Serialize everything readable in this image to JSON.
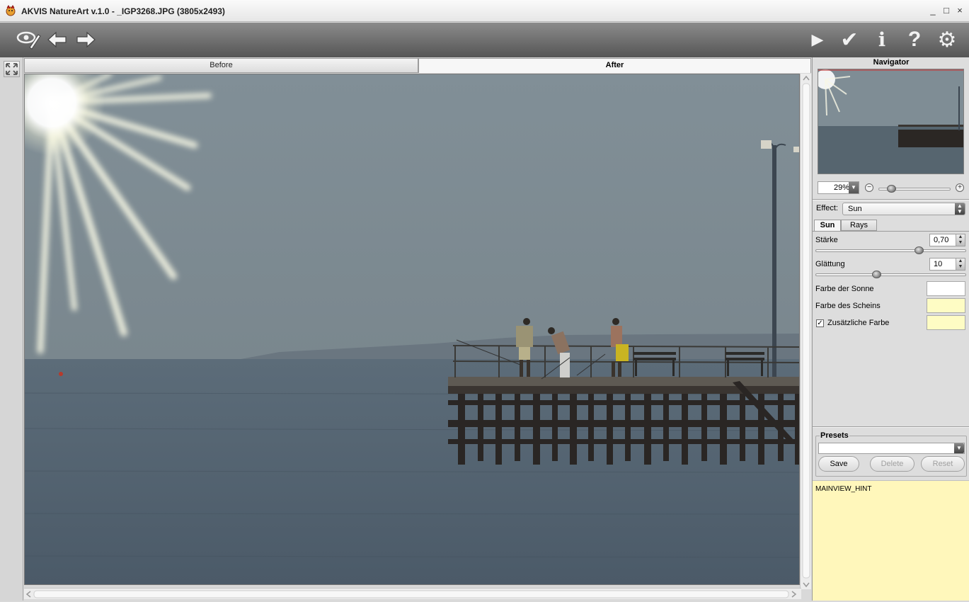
{
  "window": {
    "title": "AKVIS NatureArt v.1.0 - _IGP3268.JPG (3805x2493)",
    "controls": [
      "_",
      "□",
      "×"
    ]
  },
  "toolbar": {
    "left_icons": [
      "eye-brush-icon",
      "undo-arrow-icon",
      "redo-arrow-icon"
    ],
    "right_icons": [
      "play-icon",
      "checkmark-icon",
      "info-icon",
      "help-icon",
      "settings-gear-icon"
    ],
    "play_icon_glyph": "▶",
    "apply_icon_glyph": "✔",
    "info_icon_glyph": "i",
    "help_icon_glyph": "?",
    "settings_icon_glyph": "⚙"
  },
  "view_tabs": {
    "before": "Before",
    "after": "After",
    "active": "After"
  },
  "navigator": {
    "title": "Navigator",
    "zoom": "29%",
    "zoom_level_fraction": 0.14,
    "zoom_out": "−",
    "zoom_in": "+",
    "dropdown_arrow": "▼"
  },
  "effect": {
    "label": "Effect:",
    "value": "Sun"
  },
  "param_tabs": {
    "sun": "Sun",
    "rays": "Rays",
    "active": "Sun"
  },
  "params": {
    "staerke": {
      "label": "Stärke",
      "value": "0,70",
      "fraction": 0.7
    },
    "glaettung": {
      "label": "Glättung",
      "value": "10",
      "fraction": 0.4
    },
    "farbe_sonne": {
      "label": "Farbe der Sonne",
      "color": "#ffffff"
    },
    "farbe_schein": {
      "label": "Farbe des Scheins",
      "color": "#fefcc4"
    },
    "zusatz": {
      "label": "Zusätzliche Farbe",
      "checked": true,
      "check_glyph": "✓",
      "color": "#fefcc4"
    }
  },
  "presets": {
    "title": "Presets",
    "selected": "",
    "save": "Save",
    "delete": "Delete",
    "reset": "Reset"
  },
  "hint": {
    "text": "MAINVIEW_HINT"
  },
  "colors": {
    "sky": "#7d8b93",
    "sea": "#52616e",
    "hint_bg": "#fff7bb"
  }
}
